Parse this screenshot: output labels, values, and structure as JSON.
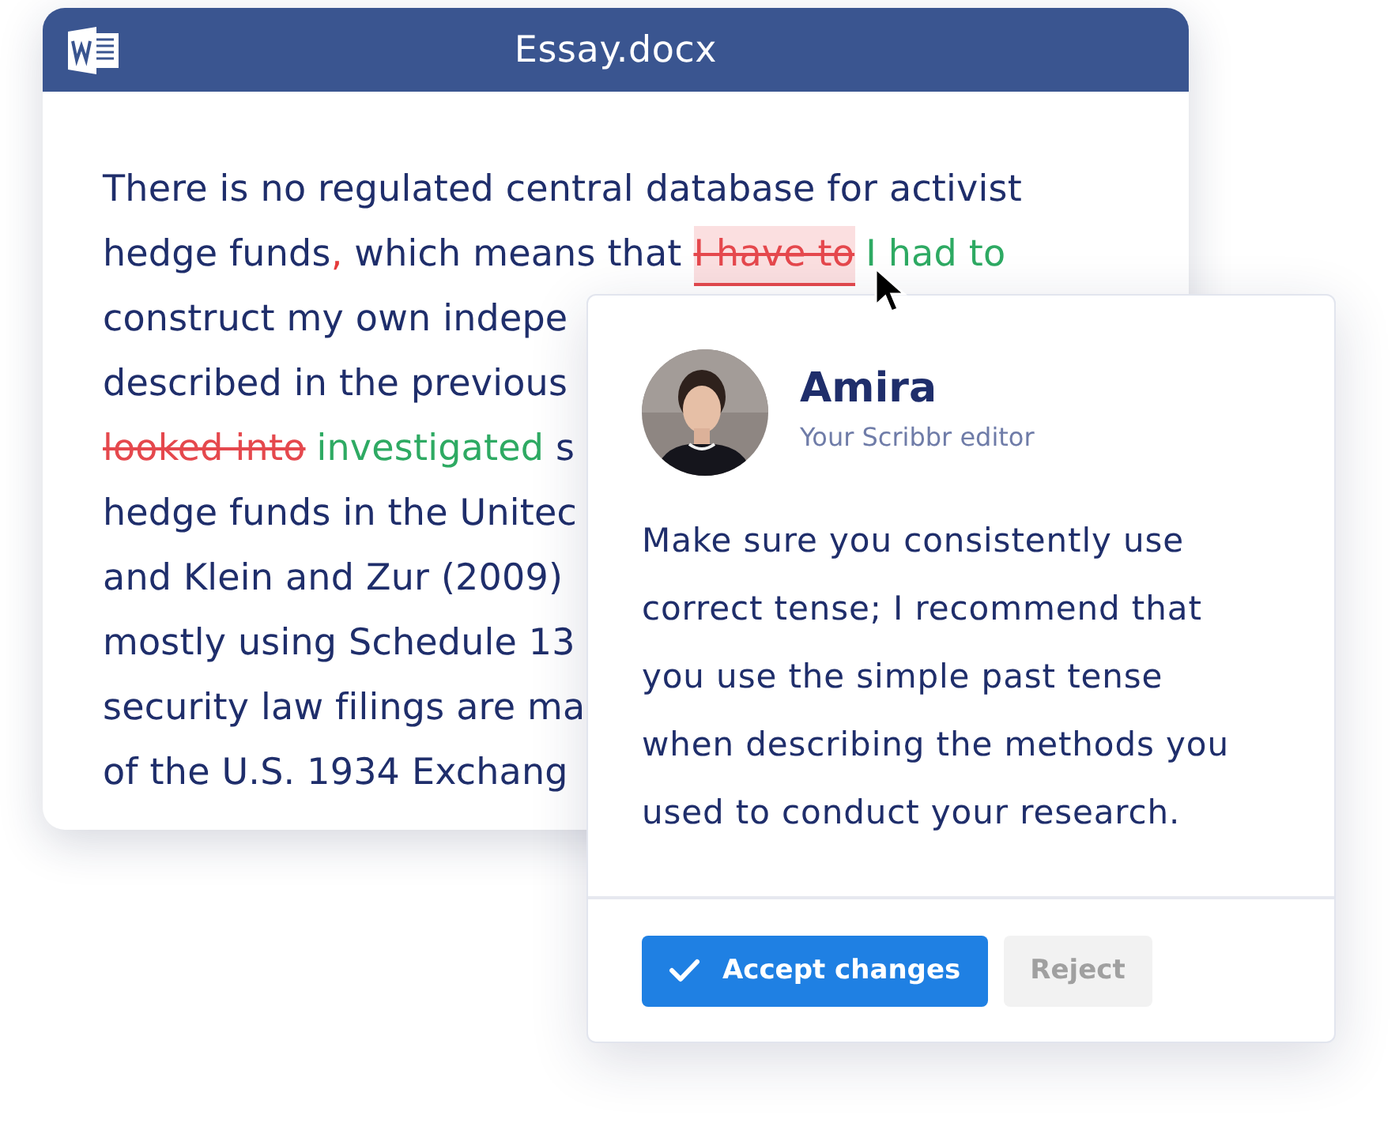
{
  "document": {
    "title": "Essay.docx",
    "lines": [
      [
        {
          "text": "There is no regulated central database for activist",
          "kind": "plain"
        }
      ],
      [
        {
          "text": "hedge funds",
          "kind": "plain"
        },
        {
          "text": ",",
          "kind": "punct"
        },
        {
          "text": " which means that ",
          "kind": "plain"
        },
        {
          "text": "I have to",
          "kind": "deleted",
          "selected": true
        },
        {
          "text": "I had to",
          "kind": "inserted"
        }
      ],
      [
        {
          "text": "construct my own indepe",
          "kind": "plain"
        }
      ],
      [
        {
          "text": "described in the previous",
          "kind": "plain"
        }
      ],
      [
        {
          "text": "looked into",
          "kind": "deleted",
          "selected": false
        },
        {
          "text": "investigated",
          "kind": "inserted"
        },
        {
          "text": " s",
          "kind": "plain"
        }
      ],
      [
        {
          "text": "hedge funds in the Unitec",
          "kind": "plain"
        }
      ],
      [
        {
          "text": "and Klein and Zur (2009)",
          "kind": "plain"
        }
      ],
      [
        {
          "text": "mostly using Schedule 13",
          "kind": "plain"
        }
      ],
      [
        {
          "text": "security law filings are ma",
          "kind": "plain"
        }
      ],
      [
        {
          "text": "of the U.S. 1934 Exchang",
          "kind": "plain"
        }
      ]
    ]
  },
  "comment": {
    "name": "Amira",
    "role": "Your Scribbr editor",
    "text": "Make sure you consistently use correct tense; I recommend that you use the simple past tense when describing the methods you used to conduct your research.",
    "buttons": [
      {
        "label": "Accept changes",
        "kind": "primary",
        "disabled": false
      },
      {
        "label": "Reject",
        "kind": "secondary",
        "disabled": true
      }
    ]
  }
}
